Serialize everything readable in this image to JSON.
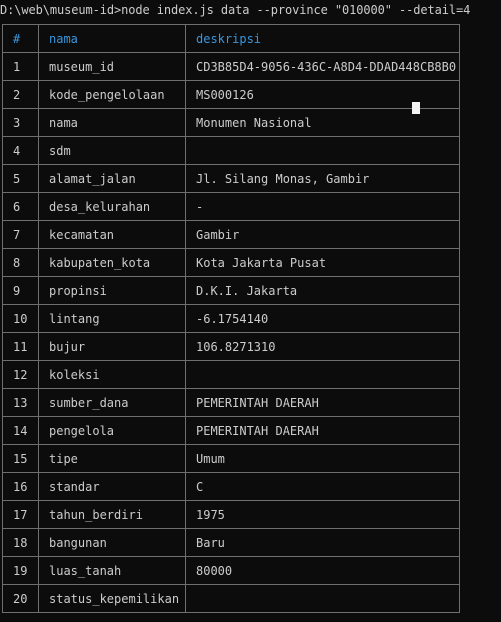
{
  "console": {
    "command_line": "D:\\web\\museum-id>node index.js data --province \"010000\" --detail=4"
  },
  "table": {
    "headers": [
      "#",
      "nama",
      "deskripsi"
    ],
    "rows": [
      {
        "no": "1",
        "nama": "museum_id",
        "deskripsi": "CD3B85D4-9056-436C-A8D4-DDAD448CB8B0"
      },
      {
        "no": "2",
        "nama": "kode_pengelolaan",
        "deskripsi": "MS000126"
      },
      {
        "no": "3",
        "nama": "nama",
        "deskripsi": "Monumen Nasional"
      },
      {
        "no": "4",
        "nama": "sdm",
        "deskripsi": ""
      },
      {
        "no": "5",
        "nama": "alamat_jalan",
        "deskripsi": "Jl. Silang Monas, Gambir"
      },
      {
        "no": "6",
        "nama": "desa_kelurahan",
        "deskripsi": "-"
      },
      {
        "no": "7",
        "nama": "kecamatan",
        "deskripsi": "Gambir"
      },
      {
        "no": "8",
        "nama": "kabupaten_kota",
        "deskripsi": "Kota Jakarta Pusat"
      },
      {
        "no": "9",
        "nama": "propinsi",
        "deskripsi": "D.K.I. Jakarta"
      },
      {
        "no": "10",
        "nama": "lintang",
        "deskripsi": "-6.1754140"
      },
      {
        "no": "11",
        "nama": "bujur",
        "deskripsi": "106.8271310"
      },
      {
        "no": "12",
        "nama": "koleksi",
        "deskripsi": ""
      },
      {
        "no": "13",
        "nama": "sumber_dana",
        "deskripsi": "PEMERINTAH DAERAH"
      },
      {
        "no": "14",
        "nama": "pengelola",
        "deskripsi": "PEMERINTAH DAERAH"
      },
      {
        "no": "15",
        "nama": "tipe",
        "deskripsi": "Umum"
      },
      {
        "no": "16",
        "nama": "standar",
        "deskripsi": "C"
      },
      {
        "no": "17",
        "nama": "tahun_berdiri",
        "deskripsi": "1975"
      },
      {
        "no": "18",
        "nama": "bangunan",
        "deskripsi": "Baru"
      },
      {
        "no": "19",
        "nama": "luas_tanah",
        "deskripsi": "80000"
      },
      {
        "no": "20",
        "nama": "status_kepemilikan",
        "deskripsi": ""
      }
    ]
  },
  "colors": {
    "background": "#0c0c0c",
    "text": "#cccccc",
    "header_text": "#3a96dd",
    "border": "#6f6f6f",
    "cursor": "#f2f2f2"
  }
}
